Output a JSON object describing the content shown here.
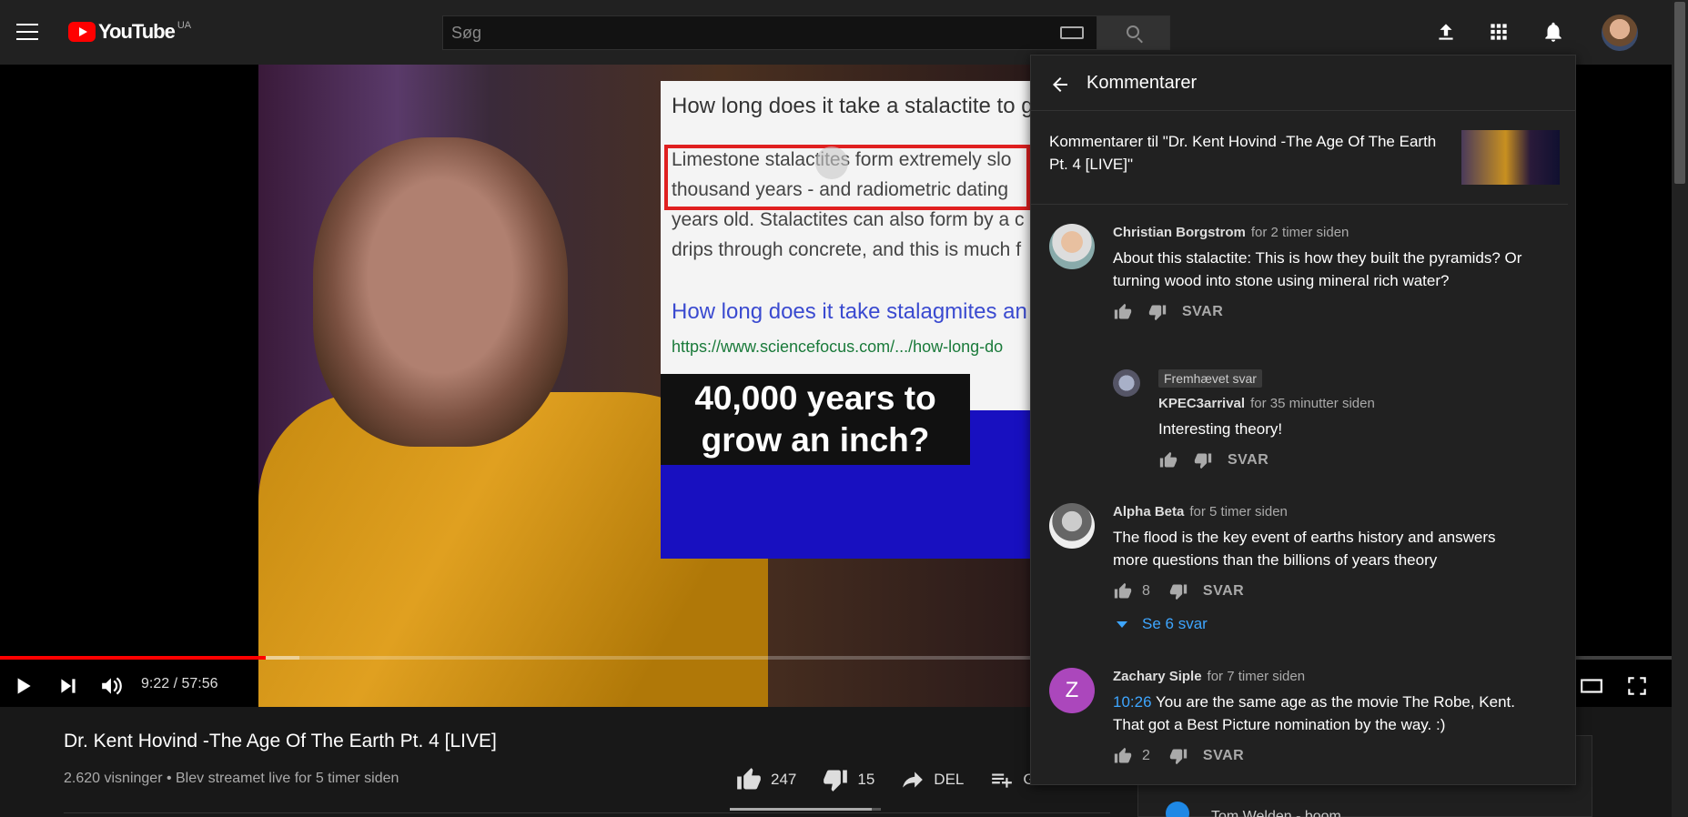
{
  "masthead": {
    "logo_text": "YouTube",
    "country": "UA",
    "search_placeholder": "Søg",
    "icons": [
      "menu-icon",
      "keyboard-icon",
      "search-icon",
      "upload-icon",
      "apps-icon",
      "bell-icon"
    ]
  },
  "player": {
    "time": "9:22 / 57:56",
    "progress_played": 0.159,
    "progress_buffered": 0.179,
    "slide": {
      "question": "How long does it take a stalactite to g",
      "body_lines": [
        "Limestone stalactites form extremely slo",
        "thousand years - and radiometric dating",
        "years old. Stalactites can also form by a c",
        "drips through concrete, and this is much f"
      ],
      "link": "How long does it take stalagmites an",
      "url": "https://www.sciencefocus.com/.../how-long-do",
      "caption": [
        "40,000 years to",
        "grow an inch?"
      ]
    }
  },
  "video": {
    "title": "Dr. Kent Hovind -The Age Of The Earth Pt. 4 [LIVE]",
    "views_text": "2.620 visninger • Blev streamet live for 5 timer siden",
    "likes": "247",
    "dislikes": "15",
    "share_label": "DEL",
    "save_label": "GEM",
    "like_ratio": 0.94
  },
  "comments_panel": {
    "title": "Kommentarer",
    "context": "Kommentarer til \"Dr. Kent Hovind -The Age Of The Earth Pt. 4 [LIVE]\"",
    "reply_label": "SVAR",
    "comments": [
      {
        "author": "Christian Borgstrom",
        "time": "for 2 timer siden",
        "text": "About this stalactite: This is how they built the pyramids? Or turning wood into stone using mineral rich water?",
        "likes": ""
      },
      {
        "badge": "Fremhævet svar",
        "author": "KPEC3arrival",
        "time": "for 35 minutter siden",
        "text": "Interesting theory!",
        "likes": ""
      },
      {
        "author": "Alpha Beta",
        "time": "for 5 timer siden",
        "text": "The flood is the key event of earths history and answers more questions than the billions of years theory",
        "likes": "8",
        "show_replies": "Se 6 svar"
      },
      {
        "author": "Zachary Siple",
        "time": "for 7 timer siden",
        "avatar_letter": "Z",
        "timestamp_link": "10:26",
        "text": " You are the same age as the movie The Robe, Kent. That got a Best Picture nomination by the way. :)",
        "likes": "2"
      }
    ]
  },
  "sidebar_peek": {
    "text": "Tom Welden - boom"
  },
  "colors": {
    "accent_red": "#ff0000",
    "link_blue": "#3ea6ff",
    "avatar_purple": "#ab47bc"
  }
}
